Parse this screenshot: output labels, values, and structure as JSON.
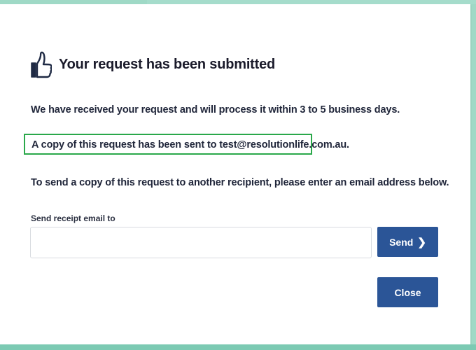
{
  "dialog": {
    "title": "Your request has been submitted",
    "icon": "thumbs-up-icon",
    "message_received": "We have received your request and will process it within 3 to 5 business days.",
    "message_copy_sent": "A copy of this request has been sent to test@resolutionlife.com.au.",
    "message_send_copy": "To send a copy of this request to another recipient, please enter an email address below."
  },
  "receipt": {
    "label": "Send receipt email to",
    "value": "",
    "placeholder": ""
  },
  "buttons": {
    "send_label": "Send",
    "send_icon": "chevron-right-icon",
    "close_label": "Close"
  },
  "colors": {
    "button_bg": "#2b5597",
    "highlight_border": "#2aa84a",
    "background_accent": "#9fd9c6"
  }
}
